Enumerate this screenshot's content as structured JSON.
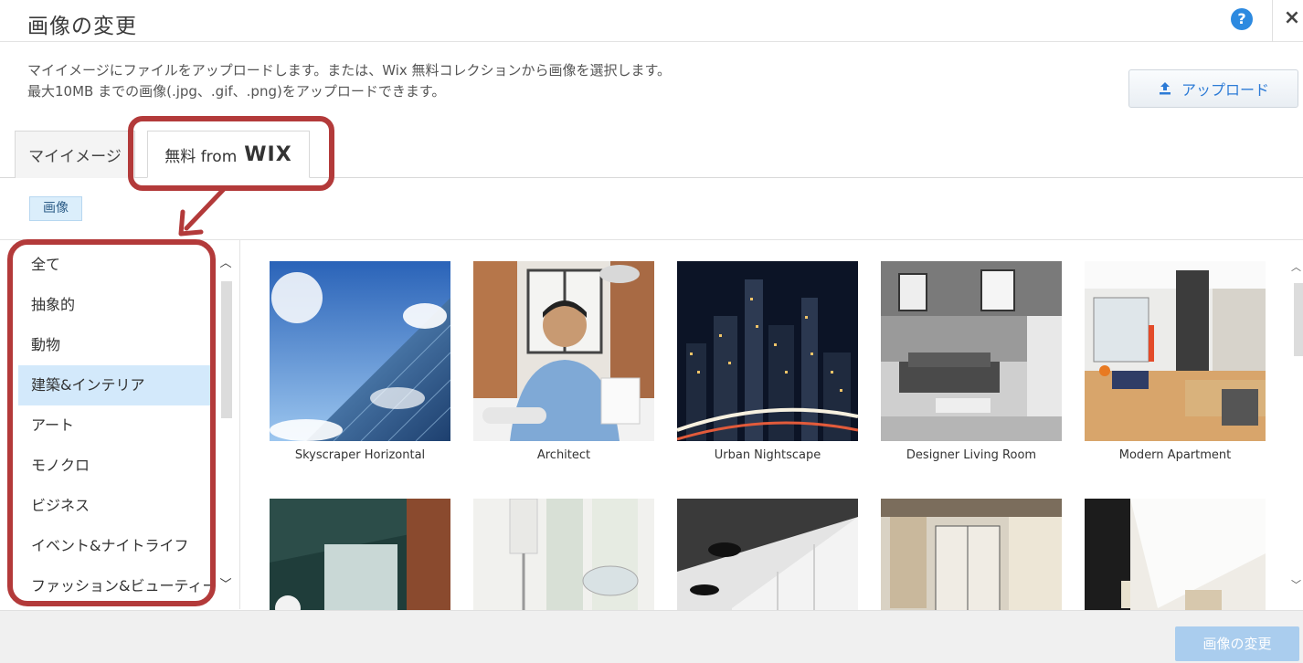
{
  "dialog": {
    "title": "画像の変更",
    "help_label": "?",
    "close_label": "×"
  },
  "description": {
    "line1": "マイイメージにファイルをアップロードします。または、Wix 無料コレクションから画像を選択します。",
    "line2": "最大10MB までの画像(.jpg、.gif、.png)をアップロードできます。"
  },
  "upload_button": {
    "label": "アップロード",
    "icon": "upload-icon",
    "color": "#2d7bd6"
  },
  "tabs": [
    {
      "label": "マイイメージ",
      "active": false
    },
    {
      "label_prefix": "無料 from",
      "label_brand": "WIX",
      "active": true
    }
  ],
  "filter": {
    "label": "画像"
  },
  "categories": [
    {
      "label": "全て",
      "active": false
    },
    {
      "label": "抽象的",
      "active": false
    },
    {
      "label": "動物",
      "active": false
    },
    {
      "label": "建築&インテリア",
      "active": true
    },
    {
      "label": "アート",
      "active": false
    },
    {
      "label": "モノクロ",
      "active": false
    },
    {
      "label": "ビジネス",
      "active": false
    },
    {
      "label": "イベント&ナイトライフ",
      "active": false
    },
    {
      "label": "ファッション&ビューティー",
      "active": false
    }
  ],
  "images": [
    {
      "caption": "Skyscraper Horizontal"
    },
    {
      "caption": "Architect"
    },
    {
      "caption": "Urban Nightscape"
    },
    {
      "caption": "Designer Living Room"
    },
    {
      "caption": "Modern Apartment"
    },
    {
      "caption": ""
    },
    {
      "caption": ""
    },
    {
      "caption": ""
    },
    {
      "caption": ""
    },
    {
      "caption": ""
    }
  ],
  "footer": {
    "change_button_label": "画像の変更"
  },
  "colors": {
    "highlight": "#b33a3a",
    "accent": "#2d8ae0",
    "active_category_bg": "#d3e9fb",
    "disabled_button": "#aacdee"
  }
}
